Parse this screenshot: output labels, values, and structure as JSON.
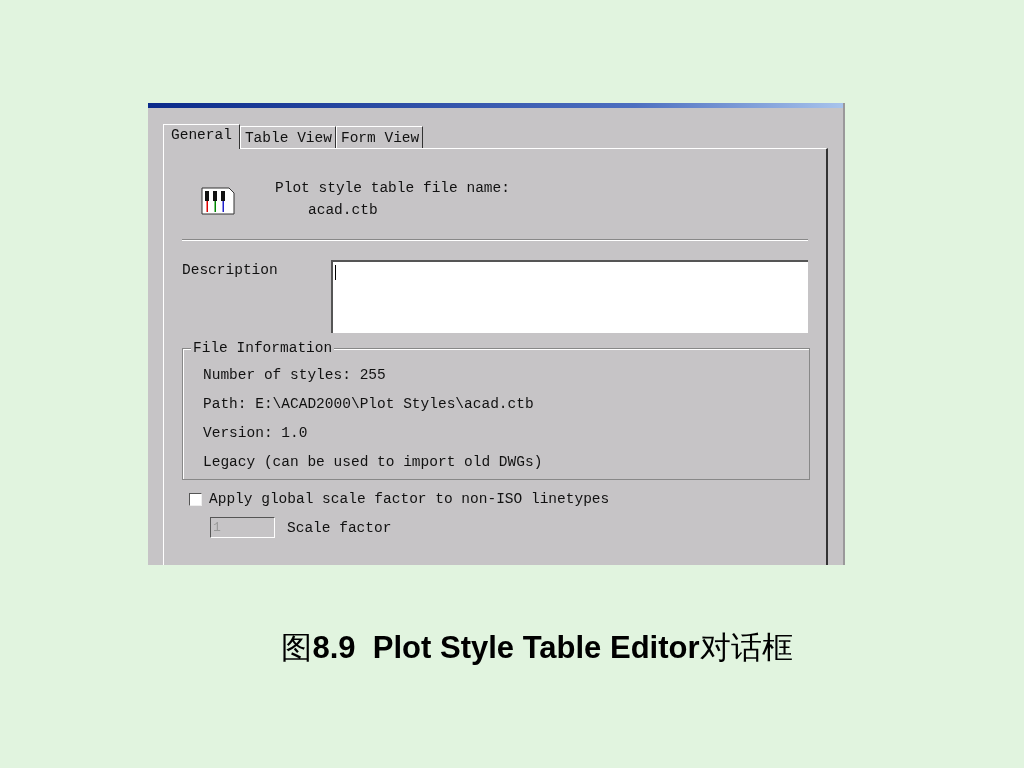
{
  "dialog": {
    "tabs": [
      {
        "label": "General",
        "selected": true
      },
      {
        "label": "Table View",
        "selected": false
      },
      {
        "label": "Form View",
        "selected": false
      }
    ],
    "file_name": {
      "label": "Plot style table file name:",
      "value": "acad.ctb"
    },
    "description": {
      "label": "Description"
    },
    "file_information": {
      "title": "File Information",
      "lines": [
        "Number of styles: 255",
        "Path: E:\\ACAD2000\\Plot Styles\\acad.ctb",
        "Version: 1.0",
        "Legacy (can be used to import old DWGs)"
      ]
    },
    "scale_option": {
      "label": "Apply global scale factor to non-ISO linetypes",
      "checked": false
    },
    "scale_factor": {
      "label": "Scale factor",
      "value": "1",
      "disabled": true
    }
  },
  "caption": "图**8.9  Plot Style Table Editor**对话框"
}
